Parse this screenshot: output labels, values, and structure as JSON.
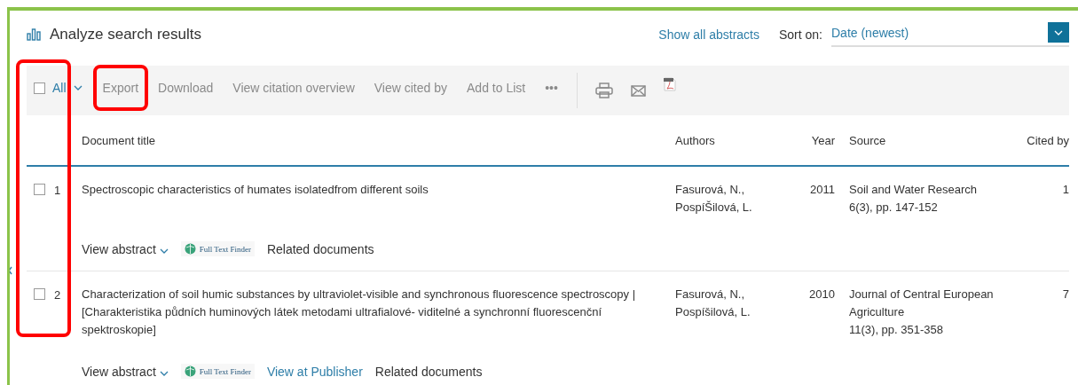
{
  "header": {
    "title": "Analyze search results",
    "show_abstracts": "Show all abstracts",
    "sort_label": "Sort on:",
    "sort_value": "Date (newest)"
  },
  "toolbar": {
    "select_all": {
      "label": "All",
      "checked": false,
      "highlighted": true
    },
    "actions": [
      {
        "label": "Export",
        "highlighted": true
      },
      {
        "label": "Download",
        "highlighted": false
      },
      {
        "label": "View citation overview",
        "highlighted": false
      },
      {
        "label": "View cited by",
        "highlighted": false
      },
      {
        "label": "Add to List",
        "highlighted": false
      }
    ],
    "more": "•••"
  },
  "table": {
    "columns": [
      "Document title",
      "Authors",
      "Year",
      "Source",
      "Cited by"
    ],
    "rows": [
      {
        "number": "1",
        "checked": false,
        "title": "Spectroscopic characteristics of humates isolatedfrom different soils",
        "authors": [
          "Fasurová, N.,",
          "PospíŠilová, L."
        ],
        "year": "2011",
        "source": [
          "Soil and Water Research",
          "6(3), pp. 147-152"
        ],
        "cited_by": "1",
        "links": [
          {
            "kind": "abstract",
            "label": "View abstract"
          },
          {
            "kind": "finder",
            "label": "Full Text Finder"
          },
          {
            "kind": "plain",
            "label": "Related documents"
          }
        ]
      },
      {
        "number": "2",
        "checked": false,
        "title": "Characterization of soil humic substances by ultraviolet-visible and synchronous fluorescence spectroscopy | [Charakteristika půdních huminových látek metodami ultrafialové- viditelné a synchronní fluorescenční spektroskopie]",
        "authors": [
          "Fasurová, N.,",
          "Pospíšilová, L."
        ],
        "year": "2010",
        "source": [
          "Journal of Central European Agriculture",
          "11(3), pp. 351-358"
        ],
        "cited_by": "7",
        "links": [
          {
            "kind": "abstract",
            "label": "View abstract"
          },
          {
            "kind": "finder",
            "label": "Full Text Finder"
          },
          {
            "kind": "link",
            "label": "View at Publisher"
          },
          {
            "kind": "plain",
            "label": "Related documents"
          }
        ]
      }
    ]
  }
}
